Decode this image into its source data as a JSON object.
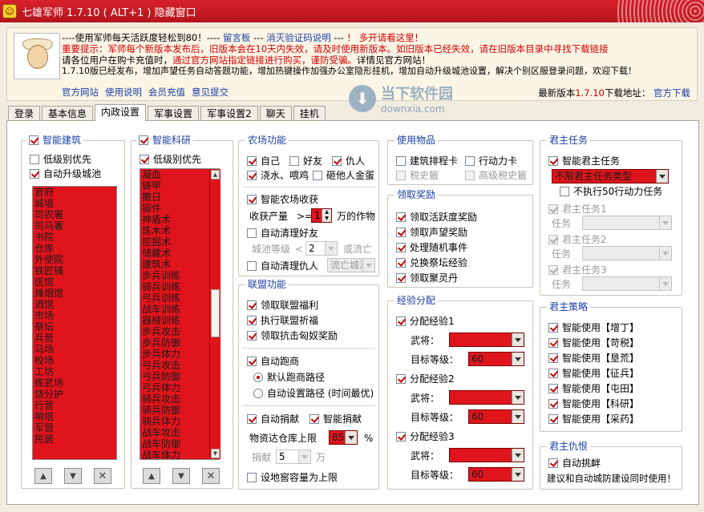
{
  "window": {
    "title": "七雄军师 1.7.10  ( ALT+1 ) 隐藏窗口"
  },
  "info": {
    "line1_a": "----使用军师每天活跃度轻松到80！----",
    "line1_board": "留言板",
    "line1_b": "---",
    "line1_captcha": "消灭验证码说明",
    "line1_c": "---",
    "line1_warn": "！ 多开请看这里！",
    "line2": "重要提示：军师每个新版本发布后，旧版本会在10天内失效，请及时使用新版本。如旧版本已经失效，请在旧版本目录中寻找下载链接",
    "line3_a": "请各位用户在购卡充值时，",
    "line3_b": "通过官方网站指定链接进行购买，谨防受骗。",
    "line3_c": "详情见官方网站！",
    "line4": "1.7.10版已经发布，增加声望任务自动答题功能，增加热键操作加强办公室隐形挂机，增加自动升级城池设置，解决个别区服登录问题，欢迎下载！",
    "links": [
      "官方网站",
      "使用说明",
      "会员充值",
      "意见提交"
    ],
    "latest_label": "最新版本",
    "latest_version": "1.7.10",
    "download_label": "下载地址：",
    "download_link": "官方下载"
  },
  "watermark": {
    "name": "当下软件园",
    "url": "downxia.com"
  },
  "tabs": [
    "登录",
    "基本信息",
    "内政设置",
    "军事设置",
    "军事设置2",
    "聊天",
    "挂机"
  ],
  "building": {
    "title": "智能建筑",
    "low_priority": "低级别优先",
    "auto_upgrade": "自动升级城池",
    "items": [
      "官府",
      "城墙",
      "司农署",
      "司马署",
      "书院",
      "仓库",
      "外使院",
      "铁匠铺",
      "医馆",
      "烽烟馆",
      "酒馆",
      "市场",
      "祭坛",
      "兵营",
      "马场",
      "校场",
      "工坊",
      "练武场",
      "饶分护",
      "行营",
      "哨塔",
      "军营",
      "民居"
    ]
  },
  "research": {
    "title": "智能科研",
    "low_priority": "低级别优先",
    "items": [
      "凝血",
      "铸甲",
      "撒日",
      "锻件",
      "神盾术",
      "炼木术",
      "挖掘术",
      "储藏术",
      "建筑术",
      "步兵训练",
      "骑兵训练",
      "弓兵训练",
      "战车训练",
      "器械训练",
      "步兵攻击",
      "步兵防御",
      "步兵体力",
      "弓兵攻击",
      "弓兵防御",
      "弓兵体力",
      "骑兵攻击",
      "骑兵防御",
      "骑兵体力",
      "战车攻击",
      "战车防御",
      "战车体力"
    ]
  },
  "farm": {
    "title": "农场功能",
    "self": "自己",
    "friend": "好友",
    "enemy": "仇人",
    "water": "浇水、喂鸡",
    "smash": "砸他人金蛋",
    "smart_harvest": "智能农场收获",
    "harvest_label": "收获产量",
    "harvest_op": ">=",
    "harvest_value": "1",
    "harvest_unit": "万的作物",
    "auto_clean_friend": "自动清理好友",
    "city_level": "城池等级",
    "city_op": "<",
    "city_value": "2",
    "or_exile": "或流亡",
    "auto_clean_enemy": "自动清理仇人",
    "exile_city": "流亡城池"
  },
  "alliance": {
    "title": "联盟功能",
    "welfare": "领取联盟福利",
    "pray": "执行联盟祈福",
    "xiongnu": "领取抗击匈奴奖励",
    "auto_run": "自动跑商",
    "default_route": "默认跑商路径",
    "custom_route": "自动设置路径 (时间最优)",
    "auto_donate": "自动捐献",
    "smart_donate": "智能捐献",
    "warehouse_label": "物资达仓库上限",
    "warehouse_value": "85",
    "percent": "%",
    "donate_label": "捐献",
    "donate_value": "5",
    "donate_unit": "万",
    "set_capacity": "设地窖容量为上限"
  },
  "items": {
    "title": "使用物品",
    "ranking_card": "建筑排程卡",
    "action_card": "行动力卡",
    "tax_card": "税史籤",
    "high_tax_card": "高级税史籤"
  },
  "rewards": {
    "title": "领取奖励",
    "active": "领取活跃度奖励",
    "fame": "领取声望奖励",
    "random": "处理随机事件",
    "altar": "兑换祭坛经验",
    "pill": "领取聚灵丹"
  },
  "exp": {
    "title": "经验分配",
    "groups": [
      {
        "label": "分配经验1",
        "general": "武将：",
        "target": "目标等级：",
        "level": "60"
      },
      {
        "label": "分配经验2",
        "general": "武将：",
        "target": "目标等级：",
        "level": "60"
      },
      {
        "label": "分配经验3",
        "general": "武将：",
        "target": "目标等级：",
        "level": "60"
      }
    ]
  },
  "lord_task": {
    "title": "君主任务",
    "smart": "智能君主任务",
    "type_select": "不限君主任务类型",
    "no_50": "不执行50行动力任务",
    "subtasks": [
      {
        "label": "君主任务1",
        "task": "任务"
      },
      {
        "label": "君主任务2",
        "task": "任务"
      },
      {
        "label": "君主任务3",
        "task": "任务"
      }
    ]
  },
  "strategy": {
    "title": "君主策略",
    "items": [
      "智能使用【增丁】",
      "智能使用【苛税】",
      "智能使用【垦荒】",
      "智能使用【征兵】",
      "智能使用【屯田】",
      "智能使用【科研】",
      "智能使用【采药】"
    ]
  },
  "revenge": {
    "title": "君主仇恨",
    "auto_provoke": "自动挑衅",
    "note": "建议和自动城防建设同时使用！"
  }
}
